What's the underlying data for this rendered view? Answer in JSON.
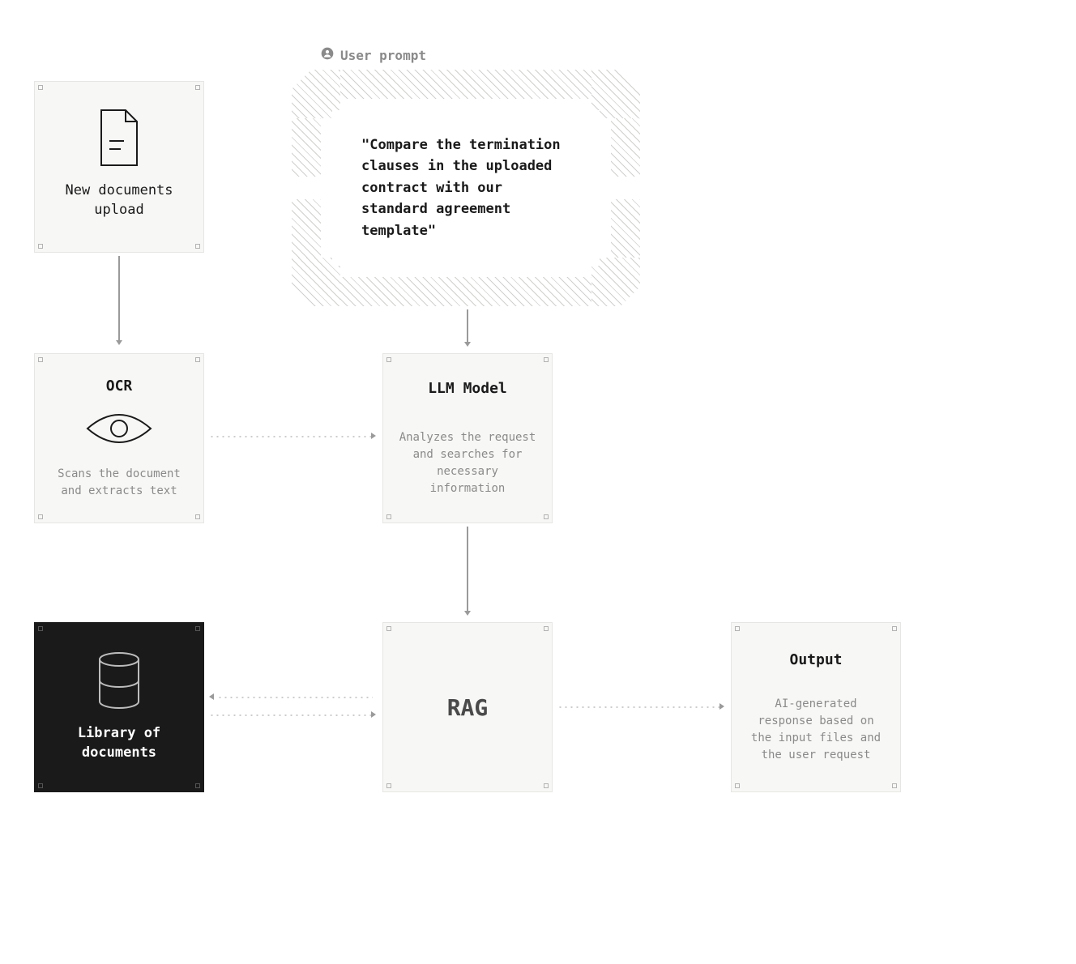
{
  "prompt": {
    "header": "User prompt",
    "text": "\"Compare the termination clauses in the uploaded contract with our standard agreement template\""
  },
  "nodes": {
    "upload": {
      "label": "New documents upload"
    },
    "ocr": {
      "title": "OCR",
      "desc": "Scans the document and extracts text"
    },
    "llm": {
      "title": "LLM Model",
      "desc": "Analyzes the request and searches for necessary information"
    },
    "library": {
      "label_line1": "Library of",
      "label_line2": "documents"
    },
    "rag": {
      "title": "RAG"
    },
    "output": {
      "title": "Output",
      "desc": "AI-generated response based on the input files and the user request"
    }
  }
}
